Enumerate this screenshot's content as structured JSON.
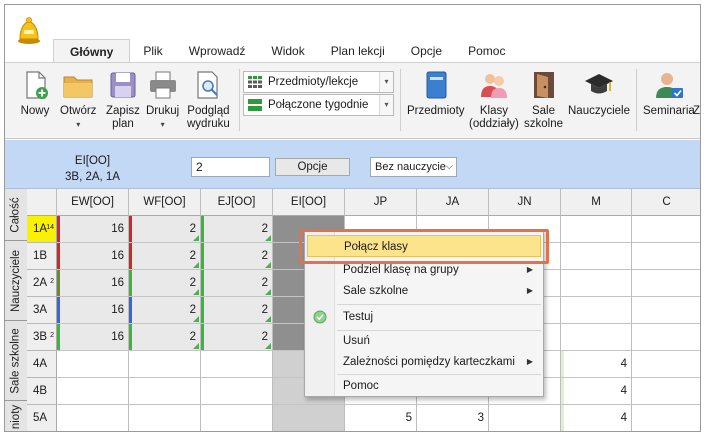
{
  "menu_tabs": [
    "Główny",
    "Plik",
    "Wprowadź",
    "Widok",
    "Plan lekcji",
    "Opcje",
    "Pomoc"
  ],
  "ribbon": {
    "new": "Nowy",
    "open": "Otwórz",
    "save_l1": "Zapisz",
    "save_l2": "plan",
    "print": "Drukuj",
    "preview_l1": "Podgląd",
    "preview_l2": "wydruku",
    "combo_subjects": "Przedmioty/lekcje",
    "combo_weeks": "Połączone tygodnie",
    "subjects": "Przedmioty",
    "classes_l1": "Klasy",
    "classes_l2": "(oddziały)",
    "rooms_l1": "Sale",
    "rooms_l2": "szkolne",
    "teachers": "Nauczyciele",
    "seminars": "Seminaria",
    "trailing": "Z"
  },
  "filterbar": {
    "title_l1": "EI[OO]",
    "title_l2": "3B, 2A, 1A",
    "input_value": "2",
    "options_button": "Opcje",
    "select_value": "Bez nauczycie"
  },
  "side_tabs": [
    "Całość",
    "Nauczyciele",
    "Sale szkolne",
    "nioty"
  ],
  "columns": [
    "EW[OO]",
    "WF[OO]",
    "EJ[OO]",
    "EI[OO]",
    "JP",
    "JA",
    "JN",
    "M",
    "C"
  ],
  "rows": [
    {
      "label": "1A",
      "sub": "14",
      "cells": [
        "16",
        "2",
        "2",
        "",
        "",
        "",
        "",
        "",
        ""
      ]
    },
    {
      "label": "1B",
      "sub": "",
      "cells": [
        "16",
        "2",
        "2",
        "",
        "",
        "",
        "",
        "",
        ""
      ]
    },
    {
      "label": "2A",
      "sub": "2",
      "cells": [
        "16",
        "2",
        "2",
        "",
        "",
        "",
        "",
        "",
        ""
      ]
    },
    {
      "label": "3A",
      "sub": "",
      "cells": [
        "16",
        "2",
        "2",
        "",
        "",
        "",
        "",
        "",
        ""
      ]
    },
    {
      "label": "3B",
      "sub": "2",
      "cells": [
        "16",
        "2",
        "2",
        "",
        "",
        "",
        "",
        "",
        ""
      ]
    },
    {
      "label": "4A",
      "sub": "",
      "cells": [
        "",
        "",
        "",
        "",
        "",
        "",
        "",
        "4",
        ""
      ]
    },
    {
      "label": "4B",
      "sub": "",
      "cells": [
        "",
        "",
        "",
        "",
        "",
        "",
        "",
        "4",
        ""
      ]
    },
    {
      "label": "5A",
      "sub": "",
      "cells": [
        "",
        "",
        "",
        "",
        "5",
        "3",
        "",
        "4",
        ""
      ]
    }
  ],
  "context_menu": {
    "items": [
      {
        "label": "Połącz klasy",
        "submenu": false,
        "highlighted": true
      },
      {
        "label": "Podziel klasę na grupy",
        "submenu": true,
        "highlighted": false
      },
      {
        "label": "Sale szkolne",
        "submenu": true,
        "highlighted": false
      },
      {
        "label": "Testuj",
        "submenu": false,
        "highlighted": false
      },
      {
        "label": "Usuń",
        "submenu": false,
        "highlighted": false
      },
      {
        "label": "Zależności pomiędzy karteczkami",
        "submenu": true,
        "highlighted": false
      },
      {
        "label": "Pomoc",
        "submenu": false,
        "highlighted": false
      }
    ]
  },
  "colors": {
    "accent_blue": "#c3d8f4",
    "selected_row": "#f8f200",
    "highlight_outline": "#e0734d",
    "menu_highlight": "#fbe48c"
  }
}
